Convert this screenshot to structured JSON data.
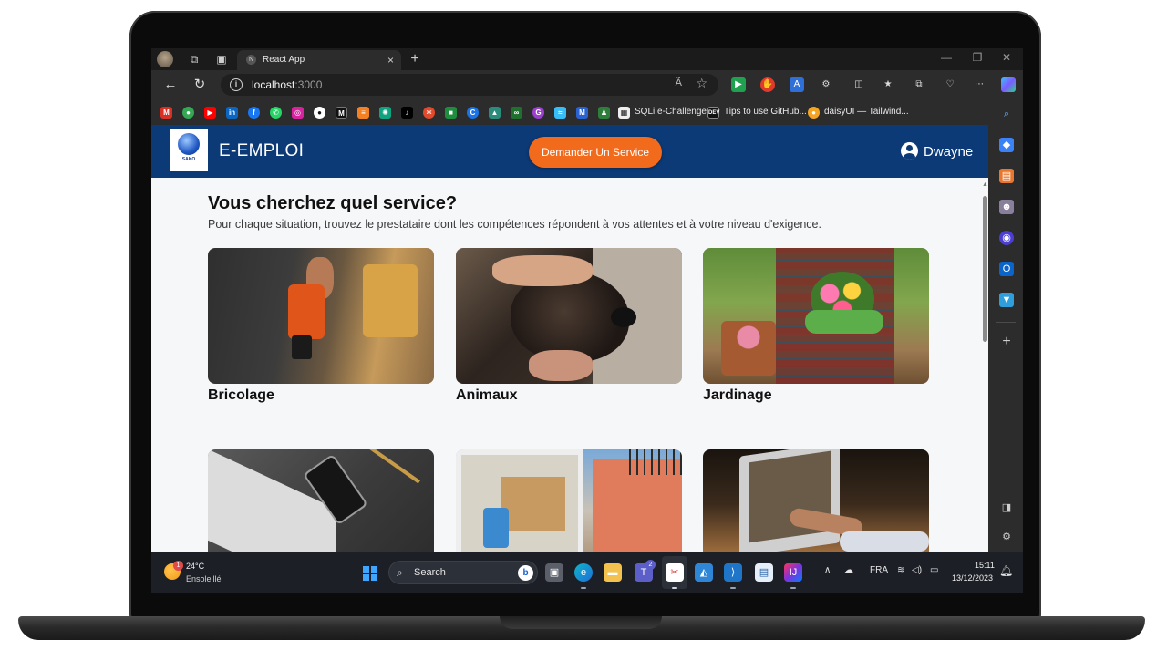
{
  "browser": {
    "tab_title": "React App",
    "tab_favicon": "N",
    "url_host": "localhost",
    "url_port": ":3000",
    "read_aloud": "Ã",
    "bookmarks": [
      {
        "label": "SQLi e-Challenge"
      },
      {
        "label": "Tips to use GitHub..."
      },
      {
        "label": "daisyUI — Tailwind..."
      }
    ]
  },
  "site": {
    "brand": "E-EMPLOI",
    "logo_text": "SAKO",
    "cta_label": "Demander Un Service",
    "user_name": "Dwayne",
    "heading": "Vous cherchez quel service?",
    "subheading": "Pour chaque situation, trouvez le prestataire dont les compétences répondent à vos attentes et à votre niveau d'exigence.",
    "services": [
      {
        "label": "Bricolage"
      },
      {
        "label": "Animaux"
      },
      {
        "label": "Jardinage"
      },
      {
        "label": ""
      },
      {
        "label": ""
      },
      {
        "label": ""
      }
    ],
    "colors": {
      "navbar": "#0b3a77",
      "cta": "#f26a1b"
    }
  },
  "taskbar": {
    "weather_temp": "24°C",
    "weather_desc": "Ensoleillé",
    "weather_badge": "1",
    "search_label": "Search",
    "language": "FRA",
    "time": "15:11",
    "date": "13/12/2023",
    "teams_badge": "2"
  }
}
